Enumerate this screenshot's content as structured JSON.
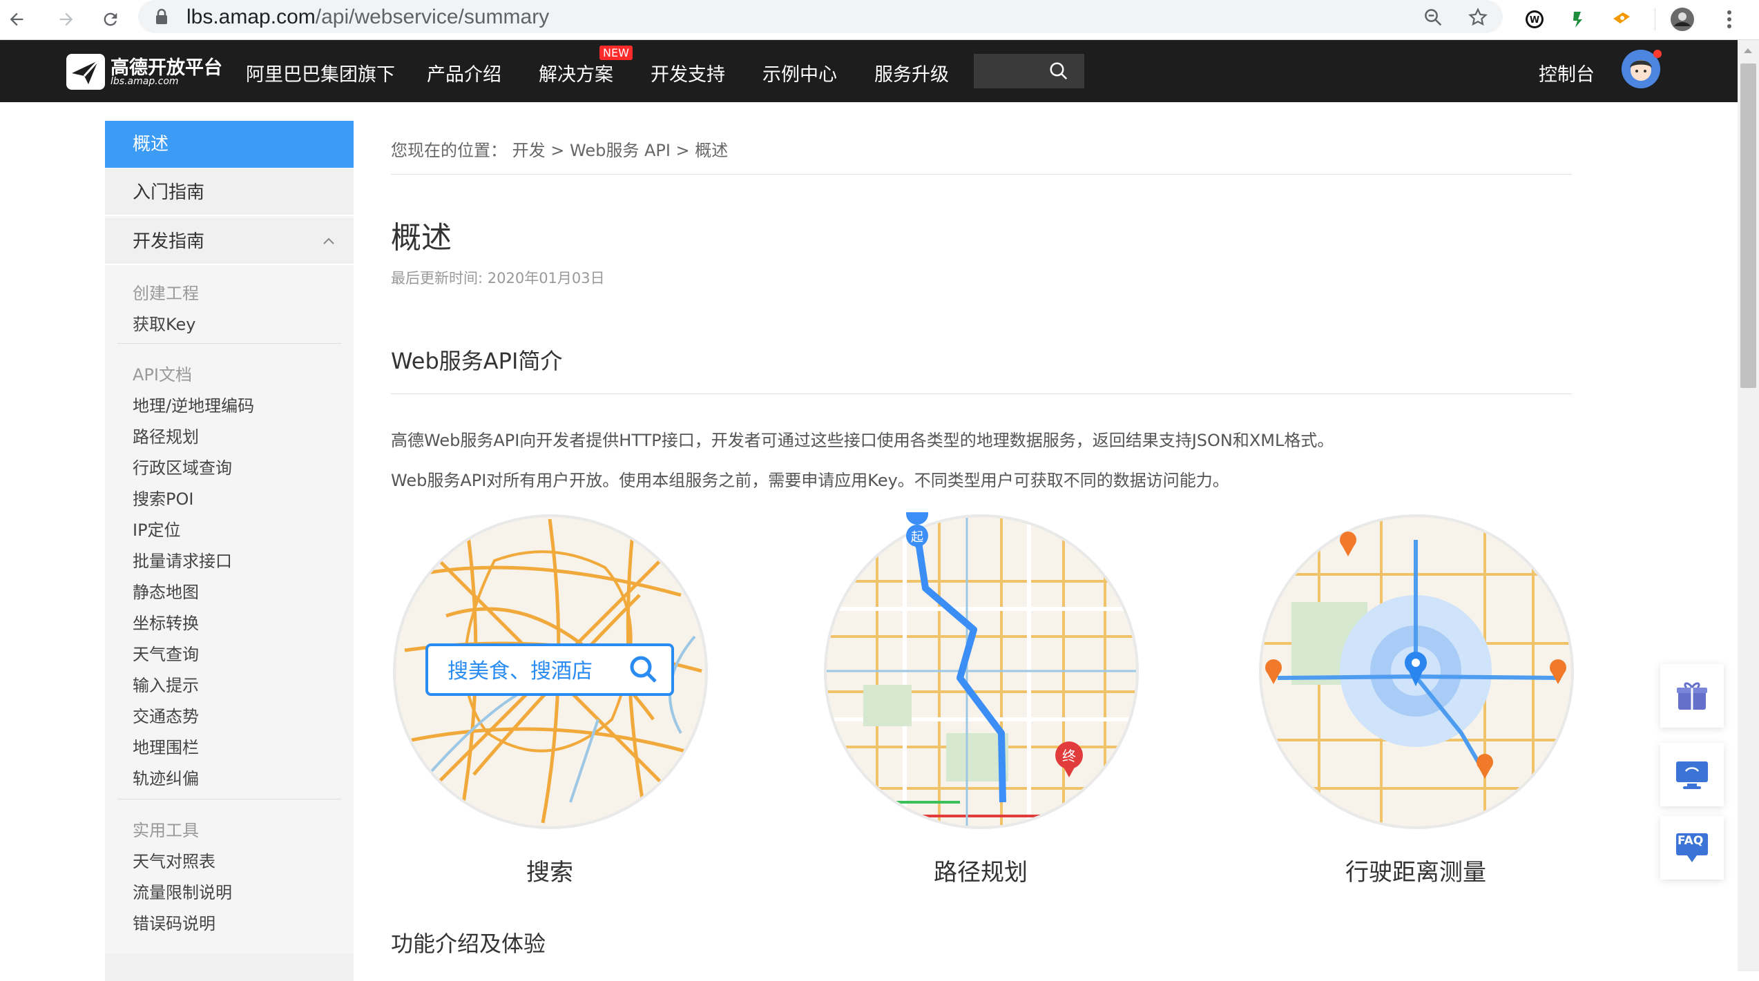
{
  "browser": {
    "url_host": "lbs.amap.com",
    "url_path": "/api/webservice/summary"
  },
  "topnav": {
    "logo_title": "高德开放平台",
    "logo_sub": "lbs.amap.com",
    "items": [
      "阿里巴巴集团旗下",
      "产品介绍",
      "解决方案",
      "开发支持",
      "示例中心",
      "服务升级"
    ],
    "new_badge": "NEW",
    "console": "控制台"
  },
  "sidebar": {
    "overview": "概述",
    "getting_started": "入门指南",
    "dev_guide": "开发指南",
    "group1": "创建工程",
    "group1_items": [
      "获取Key"
    ],
    "group2": "API文档",
    "group2_items": [
      "地理/逆地理编码",
      "路径规划",
      "行政区域查询",
      "搜索POI",
      "IP定位",
      "批量请求接口",
      "静态地图",
      "坐标转换",
      "天气查询",
      "输入提示",
      "交通态势",
      "地理围栏",
      "轨迹纠偏"
    ],
    "group3": "实用工具",
    "group3_items": [
      "天气对照表",
      "流量限制说明",
      "错误码说明"
    ]
  },
  "main": {
    "breadcrumb_prefix": "您现在的位置：",
    "breadcrumb": "开发 > Web服务 API > 概述",
    "title": "概述",
    "updated": "最后更新时间: 2020年01月03日",
    "section1": "Web服务API简介",
    "para1": "高德Web服务API向开发者提供HTTP接口，开发者可通过这些接口使用各类型的地理数据服务，返回结果支持JSON和XML格式。",
    "para2": "Web服务API对所有用户开放。使用本组服务之前，需要申请应用Key。不同类型用户可获取不同的数据访问能力。",
    "features": [
      "搜索",
      "路径规划",
      "行驶距离测量"
    ],
    "search_box_text": "搜美食、搜酒店",
    "section2": "功能介绍及体验"
  },
  "widgets": {
    "faq": "FAQ"
  },
  "colors": {
    "nav_bg": "#1d1d1d",
    "accent": "#3b9bf5",
    "map_road": "#f0a93a"
  }
}
